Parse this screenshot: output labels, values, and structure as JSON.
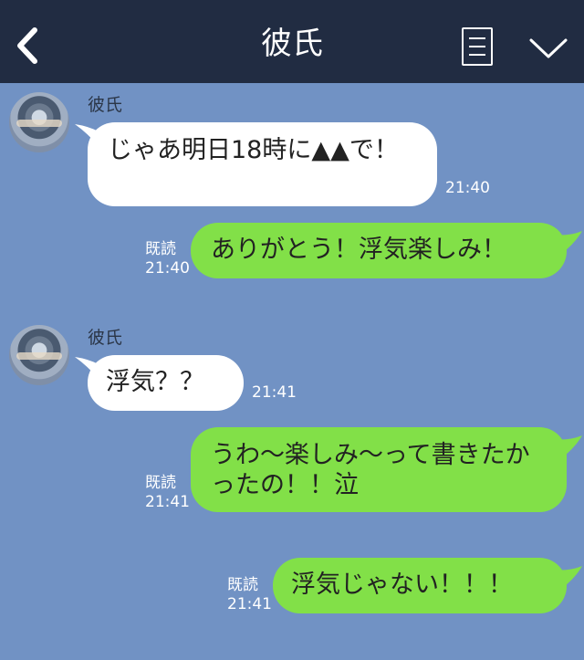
{
  "header": {
    "title": "彼氏"
  },
  "messages": [
    {
      "side": "in",
      "sender": "彼氏",
      "text": "じゃあ明日18時に▲▲で！",
      "time": "21:40"
    },
    {
      "side": "out",
      "text": "ありがとう！浮気楽しみ！",
      "read": "既読",
      "time": "21:40"
    },
    {
      "side": "in",
      "sender": "彼氏",
      "text": "浮気？？",
      "time": "21:41"
    },
    {
      "side": "out",
      "text": "うわ〜楽しみ〜って書きたかったの！！泣",
      "read": "既読",
      "time": "21:41"
    },
    {
      "side": "out",
      "text": "浮気じゃない！！！",
      "read": "既読",
      "time": "21:41"
    }
  ],
  "colors": {
    "header": "#212c42",
    "background": "#7192c4",
    "out_bubble": "#82e048",
    "in_bubble": "#ffffff"
  },
  "icons": [
    "back-chevron-icon",
    "notes-icon",
    "menu-chevron-down-icon"
  ]
}
